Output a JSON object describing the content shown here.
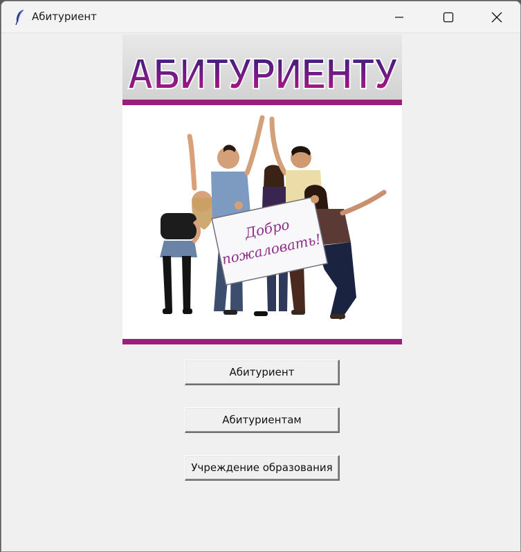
{
  "window": {
    "title": "Абитуриент",
    "controls": {
      "minimize": "minimize-icon",
      "maximize": "maximize-icon",
      "close": "close-icon"
    }
  },
  "banner": {
    "heading": "АБИТУРИЕНТУ",
    "sign_line1": "Добро",
    "sign_line2": "пожаловать!",
    "colors": {
      "heading_top": "#3a1f7a",
      "heading_bottom": "#c0117a",
      "stripe": "#9b1f7a"
    }
  },
  "buttons": {
    "applicant": "Абитуриент",
    "applicants": "Абитуриентам",
    "institution": "Учреждение образования"
  }
}
